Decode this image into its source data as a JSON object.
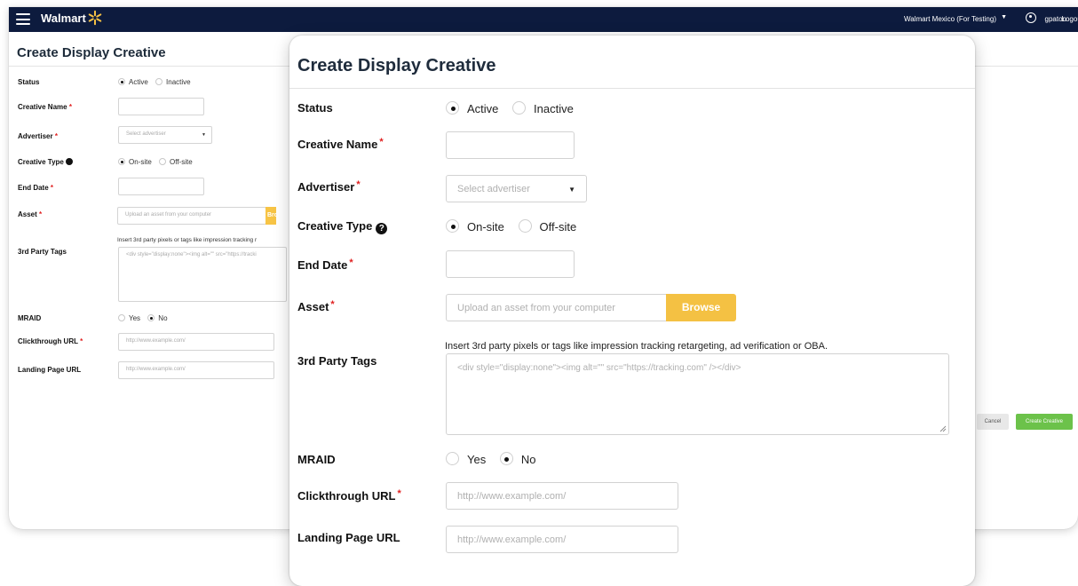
{
  "app": {
    "brand": "Walmart",
    "account": "Walmart Mexico (For Testing)",
    "user": "gpaton",
    "logout": "Logout"
  },
  "background_form": {
    "title": "Create Display Creative",
    "status_label": "Status",
    "status_options": [
      "Active",
      "Inactive"
    ],
    "creative_name_label": "Creative Name",
    "advertiser_label": "Advertiser",
    "advertiser_placeholder": "Select advertiser",
    "creative_type_label": "Creative Type",
    "creative_type_options": [
      "On-site",
      "Off-site"
    ],
    "end_date_label": "End Date",
    "asset_label": "Asset",
    "asset_placeholder": "Upload an asset from your computer",
    "browse_label": "Browse",
    "third_party_label": "3rd Party Tags",
    "third_party_hint": "Insert 3rd party pixels or tags like impression tracking r",
    "third_party_placeholder": "<div style=\"display:none\"><img alt=\"\" src=\"https://tracki",
    "mraid_label": "MRAID",
    "mraid_options": [
      "Yes",
      "No"
    ],
    "clickthrough_label": "Clickthrough URL",
    "clickthrough_placeholder": "http://www.example.com/",
    "landing_label": "Landing Page URL",
    "landing_placeholder": "http://www.example.com/",
    "cancel_label": "Cancel",
    "create_label": "Create Creative"
  },
  "form": {
    "title": "Create Display Creative",
    "status": {
      "label": "Status",
      "options": [
        "Active",
        "Inactive"
      ],
      "selected": "Active"
    },
    "creative_name": {
      "label": "Creative Name",
      "value": "",
      "required": true
    },
    "advertiser": {
      "label": "Advertiser",
      "placeholder": "Select advertiser",
      "required": true
    },
    "creative_type": {
      "label": "Creative Type",
      "options": [
        "On-site",
        "Off-site"
      ],
      "selected": "On-site"
    },
    "end_date": {
      "label": "End Date",
      "value": "",
      "required": true
    },
    "asset": {
      "label": "Asset",
      "placeholder": "Upload an asset from your computer",
      "browse": "Browse",
      "required": true
    },
    "third_party_tags": {
      "label": "3rd Party Tags",
      "hint": "Insert 3rd party pixels or tags like impression tracking retargeting, ad verification or OBA.",
      "placeholder": "<div style=\"display:none\"><img alt=\"\" src=\"https://tracking.com\" /></div>"
    },
    "mraid": {
      "label": "MRAID",
      "options": [
        "Yes",
        "No"
      ],
      "selected": "No"
    },
    "clickthrough_url": {
      "label": "Clickthrough URL",
      "placeholder": "http://www.example.com/",
      "required": true
    },
    "landing_page_url": {
      "label": "Landing Page URL",
      "placeholder": "http://www.example.com/"
    }
  },
  "colors": {
    "topbar": "#0d1b3e",
    "browse": "#f4c143",
    "create_button": "#6cc24a",
    "required_marker": "#e02020"
  },
  "icons": [
    "menu-icon",
    "walmart-spark-icon",
    "caret-down-icon",
    "user-icon",
    "help-icon",
    "resize-grip-icon"
  ]
}
